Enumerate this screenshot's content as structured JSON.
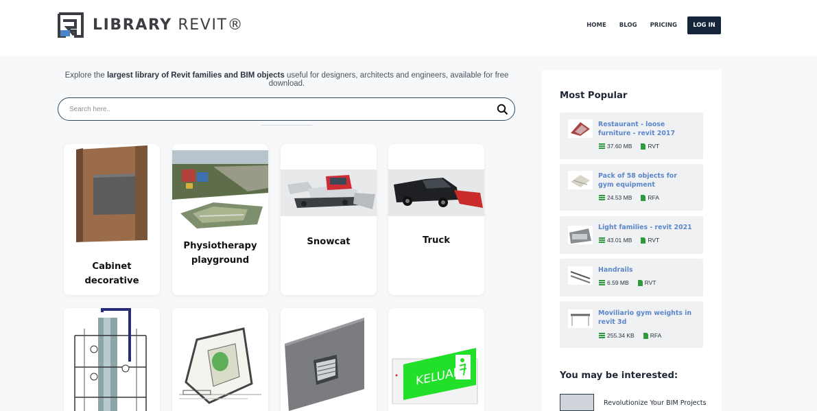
{
  "brand": {
    "logo_bold": "LIBRARY",
    "logo_light": " REVIT®"
  },
  "nav": {
    "home": "HOME",
    "blog": "BLOG",
    "pricing": "PRICING",
    "login": "LOG IN"
  },
  "intro": {
    "prefix": "Explore the ",
    "bold": "largest library of Revit families and BIM objects",
    "suffix": " useful for designers, architects and engineers, available for free download."
  },
  "search": {
    "placeholder": "Search here.."
  },
  "cards": [
    {
      "title": "Cabinet decorative"
    },
    {
      "title": "Physiotherapy playground"
    },
    {
      "title": "Snowcat"
    },
    {
      "title": "Truck"
    },
    {
      "title": ""
    },
    {
      "title": ""
    },
    {
      "title": ""
    },
    {
      "title": ""
    }
  ],
  "exit_sign_text": "KELUAR",
  "sidebar": {
    "most_popular_heading": "Most Popular",
    "popular": [
      {
        "title": "Restaurant - loose furniture - revit 2017",
        "size": "37.60 MB",
        "type": "RVT"
      },
      {
        "title": "Pack of 58 objects for gym equipment",
        "size": "24.53 MB",
        "type": "RFA"
      },
      {
        "title": "Light families - revit 2021",
        "size": "43.01 MB",
        "type": "RVT"
      },
      {
        "title": "Handrails",
        "size": "6.59 MB",
        "type": "RVT"
      },
      {
        "title": "Moviliario gym weights in revit 3d",
        "size": "255.34 KB",
        "type": "RFA"
      }
    ],
    "interest_heading": "You may be interested:",
    "interest_items": [
      {
        "title": "Revolutionize Your BIM Projects"
      }
    ]
  },
  "colors": {
    "navy": "#16243a",
    "link_blue": "#5b86c9",
    "icon_green": "#2e9a3c",
    "exit_green": "#22e02a"
  }
}
